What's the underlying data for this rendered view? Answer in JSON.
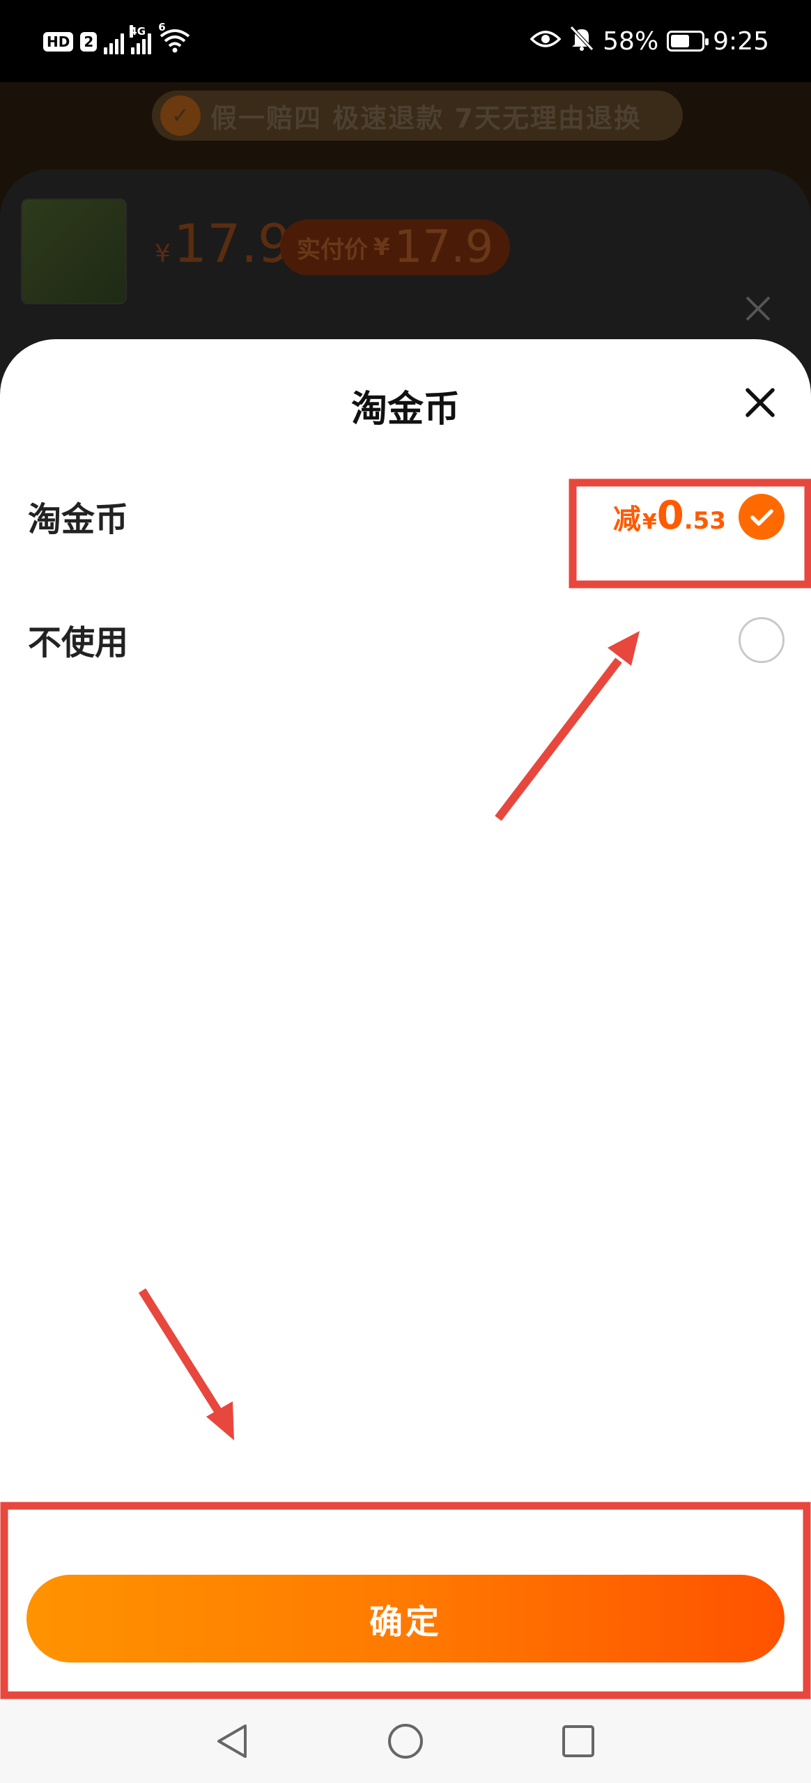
{
  "status_bar": {
    "hd_label": "HD",
    "sim_label": "2",
    "network_label": "4G",
    "wifi_label": "6",
    "battery": "58%",
    "time": "9:25"
  },
  "background": {
    "guarantee_text": "假一赔四 极速退款 7天无理由退换",
    "price_symbol": "¥",
    "price": "17.9",
    "real_price_label": "实付价",
    "real_price_symbol": "¥",
    "real_price": "17.9"
  },
  "sheet": {
    "title": "淘金币",
    "options": [
      {
        "label": "淘金币",
        "discount_prefix": "减",
        "currency": "¥",
        "discount_int": "0",
        "discount_dec": ".53",
        "selected": true
      },
      {
        "label": "不使用",
        "selected": false
      }
    ],
    "confirm_label": "确定"
  },
  "colors": {
    "accent": "#ff6a00",
    "annotation": "#e8473d",
    "confirm_gradient_start": "#ff9300",
    "confirm_gradient_end": "#ff5200"
  },
  "icons": {
    "sheet_close": "close-icon",
    "checked": "check-circle-icon",
    "unchecked": "empty-circle-icon",
    "nav_back": "back-triangle-icon",
    "nav_home": "home-circle-icon",
    "nav_recent": "recent-square-icon"
  }
}
